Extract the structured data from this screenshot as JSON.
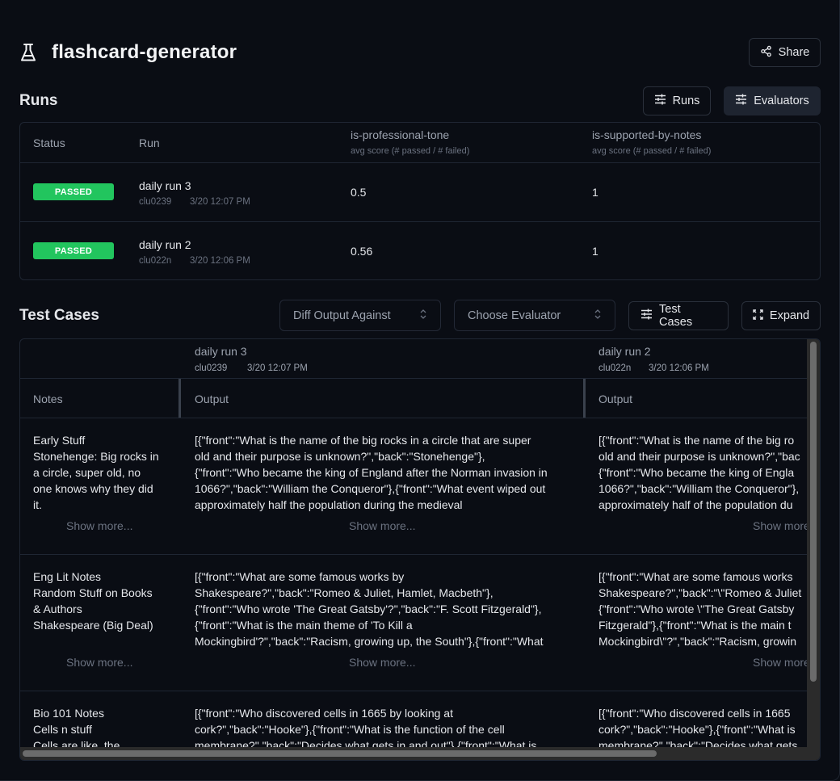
{
  "header": {
    "icon": "flask-icon",
    "title": "flashcard-generator",
    "share_label": "Share"
  },
  "runs_section": {
    "title": "Runs",
    "runs_button_label": "Runs",
    "evaluators_button_label": "Evaluators",
    "columns": {
      "status": "Status",
      "run": "Run",
      "evaluators": [
        {
          "name": "is-professional-tone",
          "subtitle": "avg score (# passed / # failed)"
        },
        {
          "name": "is-supported-by-notes",
          "subtitle": "avg score (# passed / # failed)"
        }
      ]
    },
    "rows": [
      {
        "status": "PASSED",
        "name": "daily run 3",
        "id": "clu0239",
        "time": "3/20 12:07 PM",
        "scores": [
          "0.5",
          "1"
        ]
      },
      {
        "status": "PASSED",
        "name": "daily run 2",
        "id": "clu022n",
        "time": "3/20 12:06 PM",
        "scores": [
          "0.56",
          "1"
        ]
      }
    ],
    "status_color": "#22c55e"
  },
  "test_cases": {
    "title": "Test Cases",
    "diff_select_placeholder": "Diff Output Against",
    "evaluator_select_placeholder": "Choose Evaluator",
    "test_cases_button_label": "Test Cases",
    "expand_button_label": "Expand",
    "notes_header": "Notes",
    "runs": [
      {
        "name": "daily run 3",
        "id": "clu0239",
        "time": "3/20 12:07 PM",
        "output_header": "Output"
      },
      {
        "name": "daily run 2",
        "id": "clu022n",
        "time": "3/20 12:06 PM",
        "output_header": "Output"
      }
    ],
    "show_more_label": "Show more...",
    "rows": [
      {
        "notes": [
          "Early Stuff",
          "Stonehenge: Big rocks in",
          "a circle, super old, no",
          "one knows why they did",
          "it."
        ],
        "output_run3": [
          "[{\"front\":\"What is the name of the big rocks in a circle that are super",
          "old and their purpose is unknown?\",\"back\":\"Stonehenge\"},",
          "{\"front\":\"Who became the king of England after the Norman invasion in",
          "1066?\",\"back\":\"William the Conqueror\"},{\"front\":\"What event wiped out",
          "approximately half the population during the medieval"
        ],
        "output_run2": [
          "[{\"front\":\"What is the name of the big ro",
          "old and their purpose is unknown?\",\"bac",
          "{\"front\":\"Who became the king of Engla",
          "1066?\",\"back\":\"William the Conqueror\"},",
          "approximately half of the population du"
        ]
      },
      {
        "notes": [
          "Eng Lit Notes",
          "Random Stuff on Books",
          "& Authors",
          "Shakespeare (Big Deal)"
        ],
        "output_run3": [
          "[{\"front\":\"What are some famous works by",
          "Shakespeare?\",\"back\":\"Romeo & Juliet, Hamlet, Macbeth\"},",
          "{\"front\":\"Who wrote 'The Great Gatsby'?\",\"back\":\"F. Scott Fitzgerald\"},",
          "{\"front\":\"What is the main theme of 'To Kill a",
          "Mockingbird'?\",\"back\":\"Racism, growing up, the South\"},{\"front\":\"What"
        ],
        "output_run2": [
          "[{\"front\":\"What are some famous works",
          "Shakespeare?\",\"back\":\"\\\"Romeo & Juliet",
          "{\"front\":\"Who wrote \\\"The Great Gatsby",
          "Fitzgerald\"},{\"front\":\"What is the main t",
          "Mockingbird\\\"?\",\"back\":\"Racism, growin"
        ]
      },
      {
        "notes": [
          "Bio 101 Notes",
          "Cells n stuff",
          "Cells are like, the"
        ],
        "output_run3": [
          "[{\"front\":\"Who discovered cells in 1665 by looking at",
          "cork?\",\"back\":\"Hooke\"},{\"front\":\"What is the function of the cell",
          "membrane?\",\"back\":\"Decides what gets in and out\"},{\"front\":\"What is"
        ],
        "output_run2": [
          "[{\"front\":\"Who discovered cells in 1665",
          "cork?\",\"back\":\"Hooke\"},{\"front\":\"What is",
          "membrane?\",\"back\":\"Decides what gets"
        ]
      }
    ]
  }
}
